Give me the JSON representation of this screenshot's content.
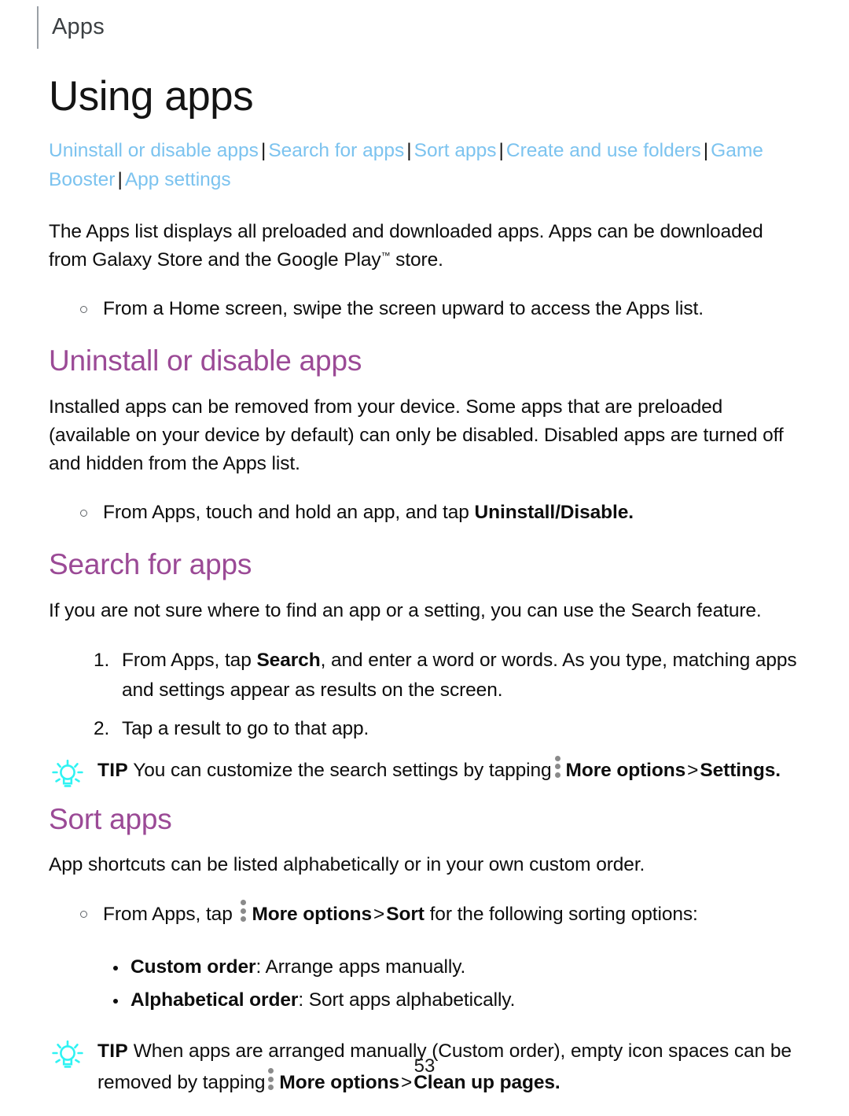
{
  "header": {
    "chapter_label": "Apps"
  },
  "page_title": "Using apps",
  "nav": {
    "separator": "|",
    "links": [
      "Uninstall or disable apps",
      "Search for apps",
      "Sort apps",
      "Create and use folders",
      "Game Booster",
      "App settings"
    ],
    "link_color": "#7cc3ef"
  },
  "intro": {
    "paragraph_part1": "The Apps list displays all preloaded and downloaded apps. Apps can be downloaded from Galaxy Store and the Google Play",
    "trademark": "™",
    "paragraph_part2": " store.",
    "bullet": "From a Home screen, swipe the screen upward to access the Apps list."
  },
  "sections": [
    {
      "heading": "Uninstall or disable apps",
      "heading_color": "#9b4a96",
      "paragraph": "Installed apps can be removed from your device. Some apps that are preloaded (available on your device by default) can only be disabled. Disabled apps are turned off and hidden from the Apps list.",
      "bullet_prefix": "From Apps, touch and hold an app, and tap ",
      "bullet_bold": "Uninstall/Disable."
    },
    {
      "heading": "Search for apps",
      "heading_color": "#9b4a96",
      "paragraph": "If you are not sure where to find an app or a setting, you can use the Search feature.",
      "steps": [
        {
          "prefix": "From Apps, tap ",
          "bold": "Search",
          "suffix": ", and enter a word or words. As you type, matching apps and settings appear as results on the screen."
        },
        {
          "prefix": "Tap a result to go to that app.",
          "bold": "",
          "suffix": ""
        }
      ],
      "tip": {
        "icon": "lightbulb-icon",
        "label": "TIP",
        "text_before_icon": "You can customize the search settings by tapping",
        "menu_icon": "more-options-kebab-icon",
        "menu_label": "More options",
        "chevron": ">",
        "target_label": "Settings."
      }
    },
    {
      "heading": "Sort apps",
      "heading_color": "#9b4a96",
      "paragraph": "App shortcuts can be listed alphabetically or in your own custom order.",
      "bullet": {
        "prefix": "From Apps, tap ",
        "menu_icon": "more-options-kebab-icon",
        "menu_label": "More options",
        "chevron": ">",
        "target_label": "Sort",
        "suffix": " for the following sorting options:"
      },
      "options": [
        {
          "term": "Custom order",
          "definition": ": Arrange apps manually."
        },
        {
          "term": "Alphabetical order",
          "definition": ": Sort apps alphabetically."
        }
      ],
      "tip": {
        "icon": "lightbulb-icon",
        "label": "TIP",
        "text_line1": "When apps are arranged manually (Custom order), empty icon spaces",
        "text_line2": "can be removed by tapping",
        "menu_icon": "more-options-kebab-icon",
        "menu_label": "More options",
        "chevron": ">",
        "target_label": "Clean up pages."
      }
    }
  ],
  "footer": {
    "page_number": "53"
  },
  "colors": {
    "tip_icon": "#2ff3f3",
    "kebab_dots": "#8a8a8a",
    "heading_purple": "#9b4a96",
    "link_blue": "#7cc3ef",
    "header_rule": "#9aa0a6"
  }
}
